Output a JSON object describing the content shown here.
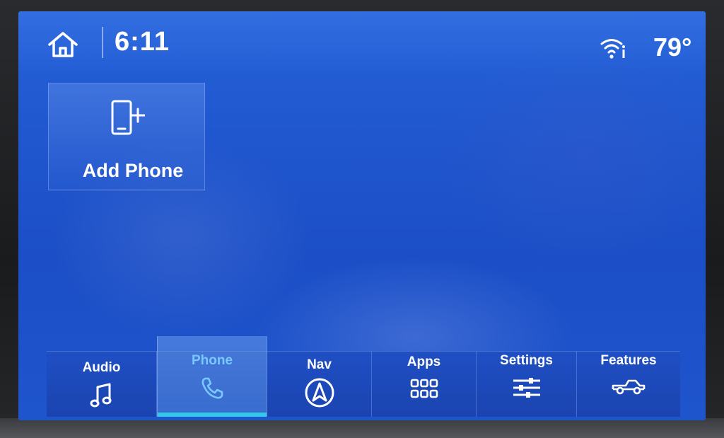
{
  "status_bar": {
    "time": "6:11",
    "temperature": "79°",
    "icons": {
      "home": "home-icon",
      "wifi": "wifi-info-icon"
    }
  },
  "main": {
    "add_phone": {
      "label": "Add Phone",
      "icon": "add-phone-icon"
    }
  },
  "nav": {
    "active": "Phone",
    "accent_color": "#34c8e8",
    "items": [
      {
        "label": "Audio",
        "icon": "music-note-icon"
      },
      {
        "label": "Phone",
        "icon": "phone-handset-icon"
      },
      {
        "label": "Nav",
        "icon": "navigation-arrow-icon"
      },
      {
        "label": "Apps",
        "icon": "apps-grid-icon"
      },
      {
        "label": "Settings",
        "icon": "settings-sliders-icon"
      },
      {
        "label": "Features",
        "icon": "truck-icon"
      }
    ]
  }
}
